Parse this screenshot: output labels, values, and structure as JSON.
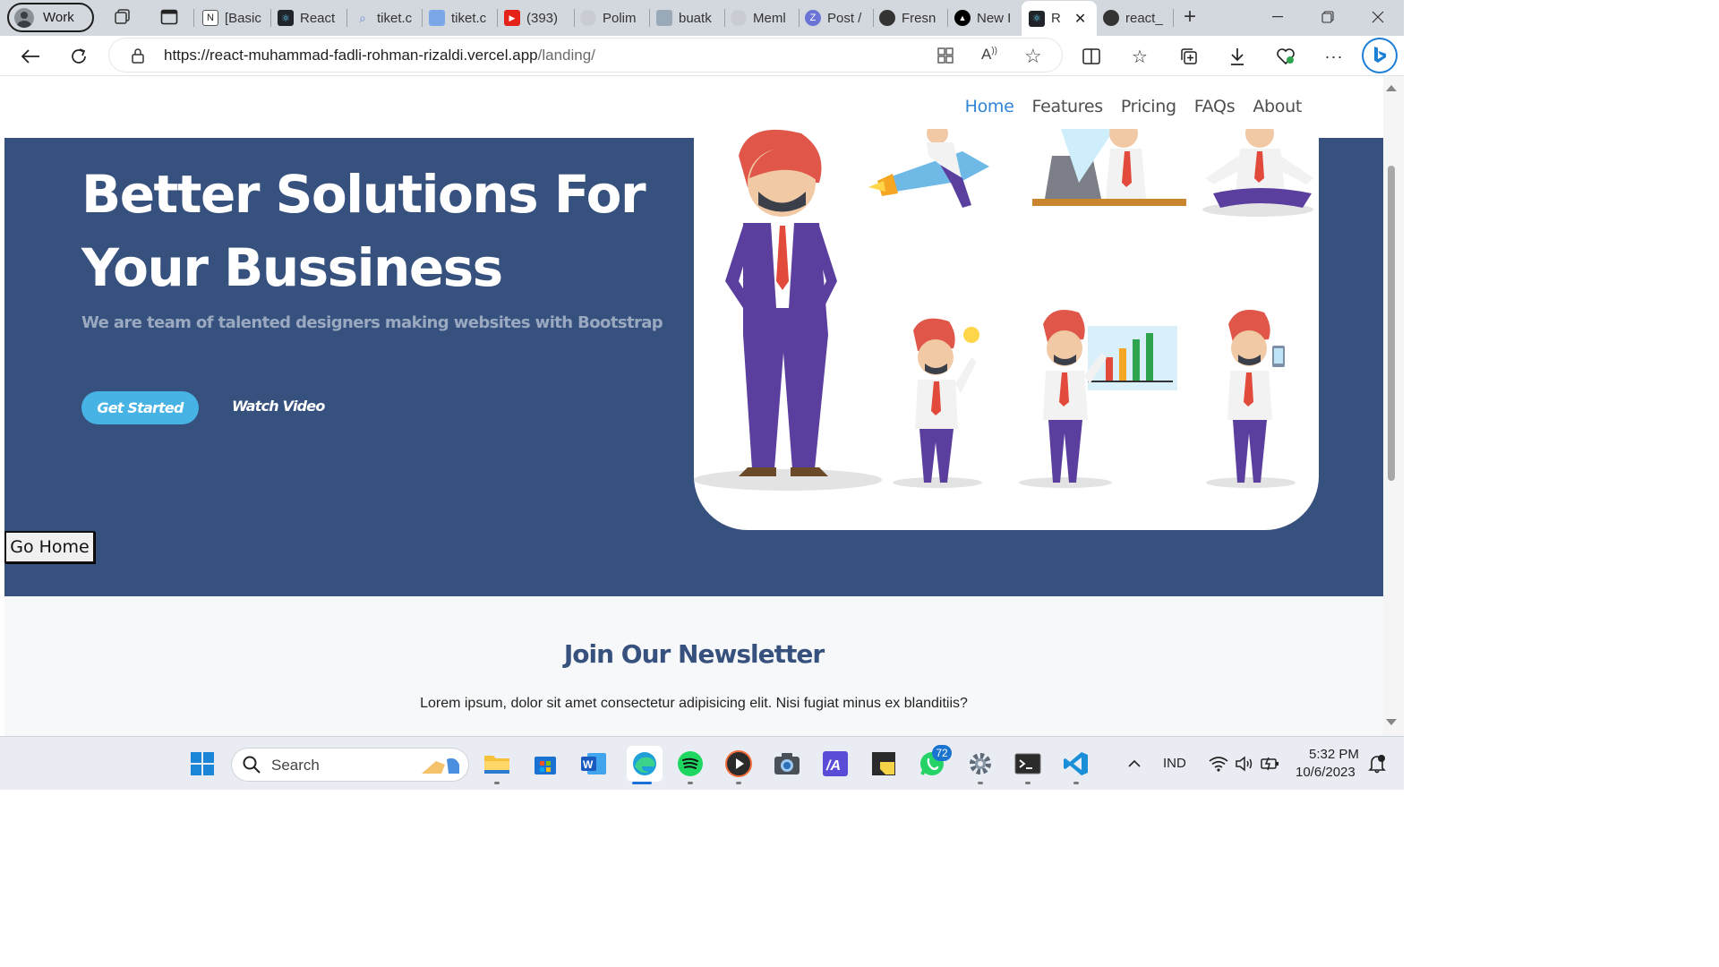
{
  "browser": {
    "profile_label": "Work",
    "tabs": [
      {
        "label": "[Basic"
      },
      {
        "label": "React"
      },
      {
        "label": "tiket.c"
      },
      {
        "label": "tiket.c"
      },
      {
        "label": "(393)"
      },
      {
        "label": "Polim"
      },
      {
        "label": "buatk"
      },
      {
        "label": "Meml"
      },
      {
        "label": "Post /"
      },
      {
        "label": "Fresn"
      },
      {
        "label": "New I"
      },
      {
        "label": "R"
      },
      {
        "label": "react_"
      }
    ],
    "url_host": "https://react-muhammad-fadli-rohman-rizaldi.vercel.app",
    "url_path": "/landing/"
  },
  "site": {
    "nav": [
      {
        "label": "Home"
      },
      {
        "label": "Features"
      },
      {
        "label": "Pricing"
      },
      {
        "label": "FAQs"
      },
      {
        "label": "About"
      }
    ],
    "hero": {
      "title_line1": "Better Solutions For",
      "title_line2": "Your Bussiness",
      "subtitle": "We are team of talented designers making websites with Bootstrap",
      "primary_button": "Get Started",
      "secondary_button": "Watch Video",
      "go_home_button": "Go Home"
    },
    "newsletter": {
      "title": "Join Our Newsletter",
      "text": "Lorem ipsum, dolor sit amet consectetur adipisicing elit. Nisi fugiat minus ex blanditiis?"
    }
  },
  "taskbar": {
    "search_placeholder": "Search",
    "whatsapp_badge": "72",
    "language": "IND",
    "time": "5:32 PM",
    "date": "10/6/2023"
  }
}
